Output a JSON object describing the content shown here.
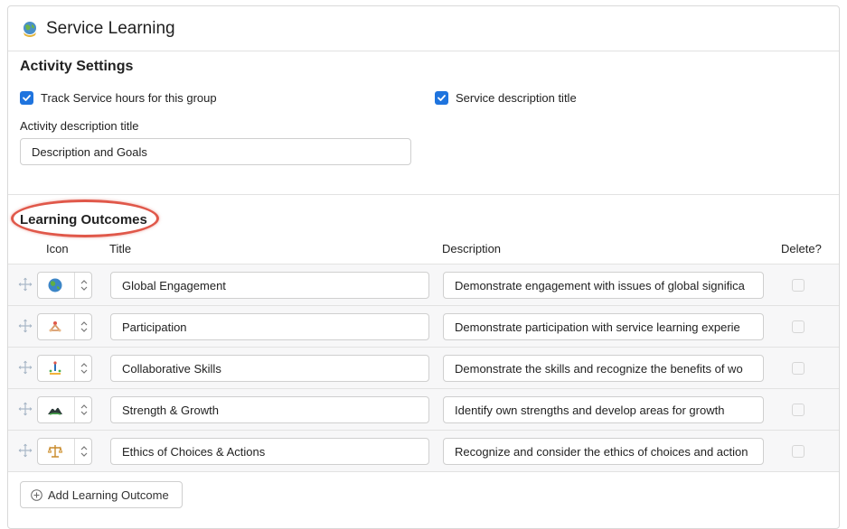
{
  "header": {
    "title": "Service Learning",
    "icon": "globe-icon"
  },
  "activity_settings": {
    "heading": "Activity Settings",
    "track_hours_label": "Track Service hours for this group",
    "track_hours_checked": true,
    "service_desc_label": "Service description title",
    "service_desc_checked": true,
    "activity_desc_label": "Activity description title",
    "activity_desc_value": "Description and Goals"
  },
  "learning_outcomes": {
    "heading": "Learning Outcomes",
    "columns": {
      "icon": "Icon",
      "title": "Title",
      "description": "Description",
      "delete": "Delete?"
    },
    "rows": [
      {
        "icon": "globe-icon",
        "title": "Global Engagement",
        "description": "Demonstrate engagement with issues of global significa",
        "delete": false
      },
      {
        "icon": "people-icon",
        "title": "Participation",
        "description": "Demonstrate participation with service learning experie",
        "delete": false
      },
      {
        "icon": "collaboration-icon",
        "title": "Collaborative Skills",
        "description": "Demonstrate the skills and recognize the benefits of wo",
        "delete": false
      },
      {
        "icon": "growth-icon",
        "title": "Strength & Growth",
        "description": "Identify own strengths and develop areas for growth",
        "delete": false
      },
      {
        "icon": "scales-icon",
        "title": "Ethics of Choices & Actions",
        "description": "Recognize and consider the ethics of choices and action",
        "delete": false
      }
    ],
    "add_button_label": "Add Learning Outcome"
  },
  "colors": {
    "accent": "#1f74de",
    "highlight": "#e0584a"
  }
}
